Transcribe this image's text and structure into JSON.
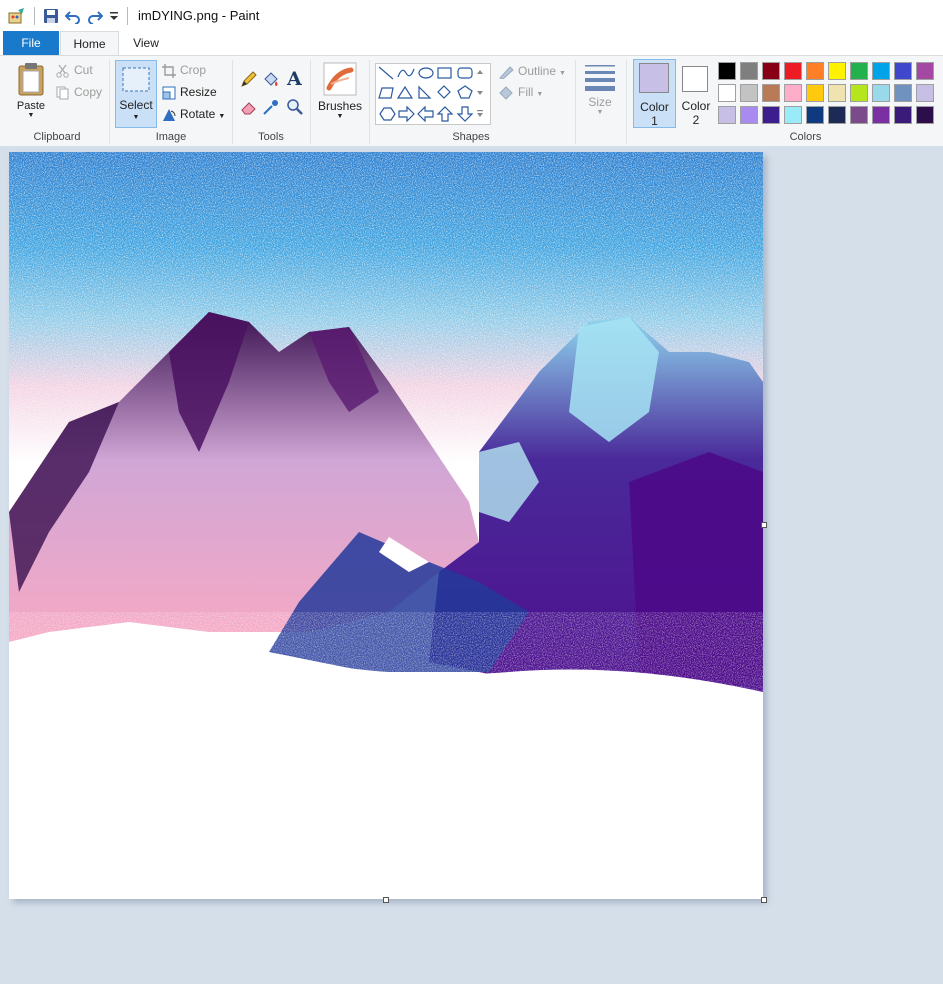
{
  "window": {
    "title": "imDYING.png - Paint"
  },
  "tabs": {
    "file": "File",
    "home": "Home",
    "view": "View"
  },
  "clipboard": {
    "paste": "Paste",
    "cut": "Cut",
    "copy": "Copy",
    "label": "Clipboard"
  },
  "image": {
    "select": "Select",
    "crop": "Crop",
    "resize": "Resize",
    "rotate": "Rotate",
    "label": "Image"
  },
  "tools": {
    "label": "Tools"
  },
  "brushes": {
    "label": "Brushes"
  },
  "shapes": {
    "outline": "Outline",
    "fill": "Fill",
    "label": "Shapes"
  },
  "size": {
    "label": "Size"
  },
  "colors": {
    "color1": "Color",
    "color1_num": "1",
    "color2": "Color",
    "color2_num": "2",
    "label": "Colors",
    "color1_value": "#c8bfe7",
    "color2_value": "#ffffff",
    "palette": [
      [
        "#000000",
        "#7f7f7f",
        "#880015",
        "#ed1c24",
        "#ff7f27",
        "#fff200",
        "#22b14c",
        "#00a2e8",
        "#3f48cc",
        "#a349a4"
      ],
      [
        "#ffffff",
        "#c3c3c3",
        "#b97a57",
        "#ffaec9",
        "#ffc90e",
        "#efe4b0",
        "#b5e61d",
        "#99d9ea",
        "#7092be",
        "#c8bfe7"
      ],
      [
        "#c8bfe7",
        "#a78bf0",
        "#3c1f8c",
        "#99ecf7",
        "#0f3a80",
        "#1c2a55",
        "#7b4a8a",
        "#7a2fa3",
        "#3a1b7a",
        "#2c0f4a"
      ]
    ]
  }
}
